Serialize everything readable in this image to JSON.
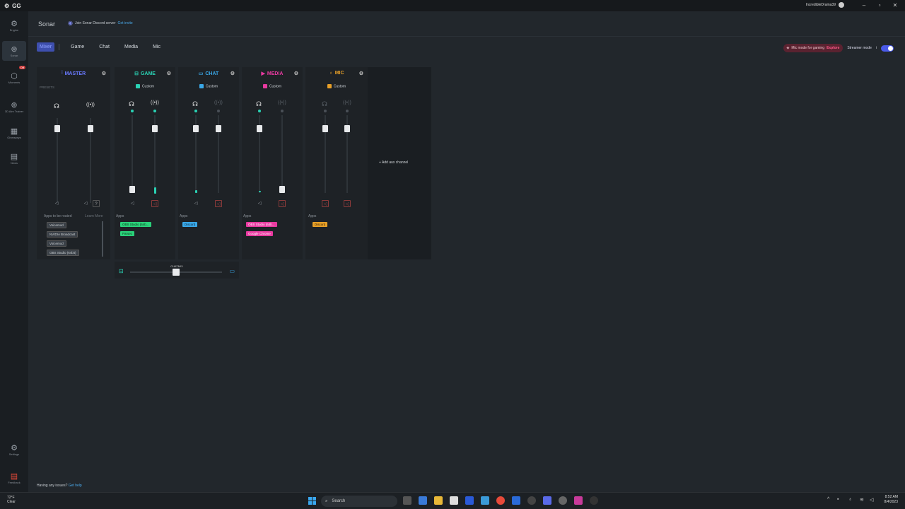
{
  "titlebar": {
    "logo": "GG",
    "username": "IncredibleDrama39"
  },
  "sidebar": {
    "items": [
      {
        "label": "Engine",
        "icon": "gear-icon"
      },
      {
        "label": "Sonar",
        "icon": "sonar-icon"
      },
      {
        "label": "Moments",
        "icon": "moments-icon",
        "badge": "Off"
      },
      {
        "label": "3D Aim Trainer",
        "icon": "aim-icon"
      },
      {
        "label": "Giveaways",
        "icon": "gift-icon"
      },
      {
        "label": "News",
        "icon": "news-icon"
      },
      {
        "label": "Settings",
        "icon": "settings-icon"
      },
      {
        "label": "Feedback",
        "icon": "feedback-icon"
      }
    ]
  },
  "header": {
    "title": "Sonar",
    "discord_text": "Join Sonar Discord server",
    "discord_link": "Get invite"
  },
  "tabs": [
    "Mixer",
    "Game",
    "Chat",
    "Media",
    "Mic"
  ],
  "topright": {
    "mic_mode": "Mic mode for gaming",
    "explore": "Explore",
    "streamer_mode": "Streamer mode",
    "info": "i"
  },
  "channels": [
    {
      "name": "MASTER",
      "color": "#6a7aff",
      "preset": "PRESETS"
    },
    {
      "name": "GAME",
      "color": "#2ad2b4",
      "preset": "Custom"
    },
    {
      "name": "CHAT",
      "color": "#3aa8e8",
      "preset": "Custom"
    },
    {
      "name": "MEDIA",
      "color": "#e83aa0",
      "preset": "Custom"
    },
    {
      "name": "MIC",
      "color": "#e8a028",
      "preset": "Custom"
    }
  ],
  "master": {
    "apps_to_be_routed": "Apps to be routed",
    "learn_more": "Learn More",
    "routed_apps": [
      "Voicemod",
      "NVIDIA Broadcast",
      "Voicemod",
      "OBS Studio (64bit)"
    ]
  },
  "apps_label": "Apps",
  "game_apps": [
    "OBS Studio (64b...",
    "Parsec"
  ],
  "chat_apps": [
    "Discord"
  ],
  "media_apps": [
    "OBS Studio (64b...",
    "Google Chrome"
  ],
  "mic_apps": [
    "Discord"
  ],
  "aux": {
    "add": "Add aux channel"
  },
  "chatmix": {
    "label": "CHATMIX"
  },
  "footer": {
    "issues": "Having any issues?",
    "help": "Get help"
  },
  "taskbar": {
    "temp": "72°F",
    "weather": "Clear",
    "search": "Search",
    "time": "8:52 AM",
    "date": "8/4/2023"
  },
  "levels": {
    "master_headphone": 0.9,
    "master_stream": 0.9,
    "game_headphone": 0.0,
    "game_stream": 0.9,
    "chat_headphone": 0.9,
    "chat_stream": 0.9,
    "media_headphone": 0.9,
    "media_stream": 0.0,
    "mic_headphone": 0.9,
    "mic_stream": 0.9,
    "chatmix": 0.5
  }
}
